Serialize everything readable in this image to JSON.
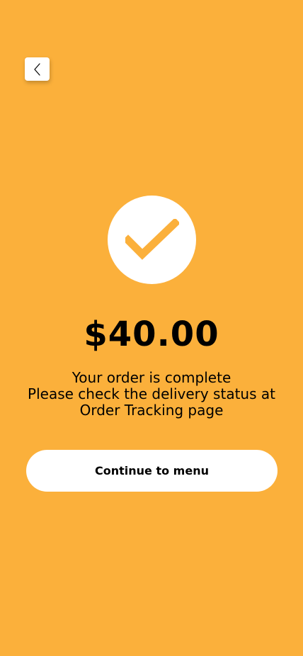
{
  "colors": {
    "background": "#FBB03B",
    "surface": "#FFFFFF",
    "check": "#FBB03B",
    "text": "#000000"
  },
  "header": {
    "back_icon": "chevron-left-icon"
  },
  "confirmation": {
    "status_icon": "checkmark-icon",
    "amount": "$40.00",
    "message_line_1": "Your order is complete",
    "message_line_2": "Please check the delivery status at",
    "message_line_3": "Order Tracking page"
  },
  "actions": {
    "continue_label": "Continue to menu"
  }
}
